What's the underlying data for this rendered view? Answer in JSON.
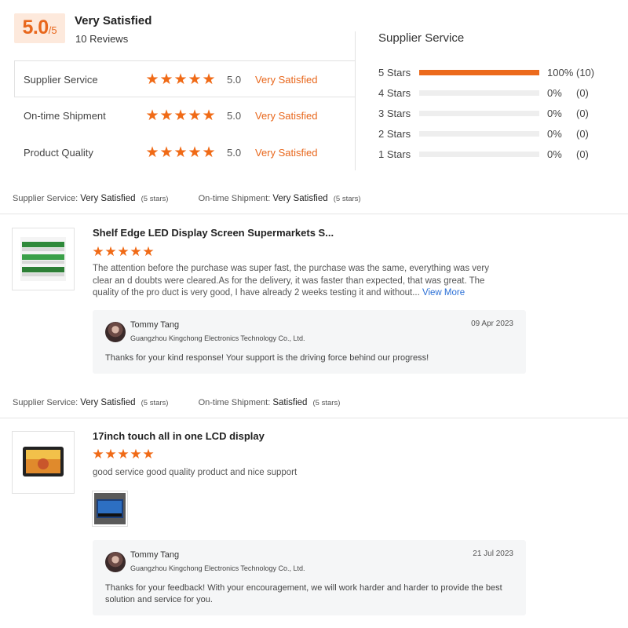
{
  "summary": {
    "score": "5.0",
    "score_suffix": "/5",
    "overall_label": "Very Satisfied",
    "review_count": "10 Reviews",
    "metrics": [
      {
        "label": "Supplier Service",
        "stars": 5,
        "score": "5.0",
        "text": "Very Satisfied"
      },
      {
        "label": "On-time Shipment",
        "stars": 5,
        "score": "5.0",
        "text": "Very Satisfied"
      },
      {
        "label": "Product Quality",
        "stars": 5,
        "score": "5.0",
        "text": "Very Satisfied"
      }
    ]
  },
  "distribution": {
    "title": "Supplier Service",
    "rows": [
      {
        "label": "5 Stars",
        "fraction": 1.0,
        "pct": "100%",
        "count": "(10)"
      },
      {
        "label": "4 Stars",
        "fraction": 0.0,
        "pct": "0%",
        "count": "(0)"
      },
      {
        "label": "3 Stars",
        "fraction": 0.0,
        "pct": "0%",
        "count": "(0)"
      },
      {
        "label": "2 Stars",
        "fraction": 0.0,
        "pct": "0%",
        "count": "(0)"
      },
      {
        "label": "1 Stars",
        "fraction": 0.0,
        "pct": "0%",
        "count": "(0)"
      }
    ]
  },
  "reviews": [
    {
      "supplier_label": "Supplier Service:",
      "supplier_value": "Very Satisfied",
      "supplier_stars": "(5 stars)",
      "shipment_label": "On-time Shipment:",
      "shipment_value": "Very Satisfied",
      "shipment_stars": "(5 stars)",
      "product_title": "Shelf Edge LED Display Screen Supermarkets S...",
      "stars": 5,
      "body": "The attention before the purchase was super fast, the purchase was the same, everything was very clear an d doubts were cleared.As for the delivery, it was faster than expected, that was great.  The quality of the pro duct is very good, I have already 2 weeks testing it and without...",
      "view_more": "View More",
      "reply": {
        "name": "Tommy Tang",
        "company": "Guangzhou Kingchong Electronics Technology Co., Ltd.",
        "date": "09 Apr 2023",
        "text": "Thanks for your kind response! Your support is the driving force behind our progress!"
      }
    },
    {
      "supplier_label": "Supplier Service:",
      "supplier_value": "Very Satisfied",
      "supplier_stars": "(5 stars)",
      "shipment_label": "On-time Shipment:",
      "shipment_value": "Satisfied",
      "shipment_stars": "(5 stars)",
      "product_title": "17inch touch all in one LCD display",
      "stars": 5,
      "body": "good service good quality product and nice support",
      "reply": {
        "name": "Tommy Tang",
        "company": "Guangzhou Kingchong Electronics Technology Co., Ltd.",
        "date": "21 Jul 2023",
        "text": "Thanks for your feedback! With your encouragement, we will work harder and harder to provide the best solution and service for you."
      }
    }
  ],
  "colors": {
    "accent": "#e8671c",
    "star": "#f06a16",
    "link": "#2a6fd6"
  },
  "icons": {
    "star": "star-icon",
    "avatar": "avatar"
  }
}
